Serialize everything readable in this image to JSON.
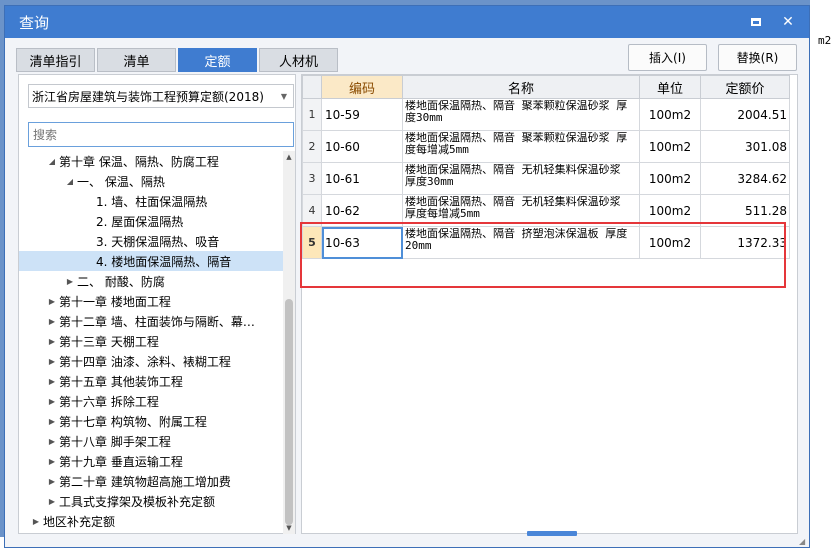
{
  "window": {
    "title": "查询"
  },
  "background": {
    "unit_text": "m2"
  },
  "tabs": [
    {
      "label": "清单指引"
    },
    {
      "label": "清单"
    },
    {
      "label": "定额"
    },
    {
      "label": "人材机"
    }
  ],
  "active_tab": "定额",
  "buttons": {
    "insert": "插入(I)",
    "replace": "替换(R)"
  },
  "quota_select": {
    "value": "浙江省房屋建筑与装饰工程预算定额(2018)"
  },
  "search": {
    "placeholder": "搜索"
  },
  "tree": [
    {
      "label": "第十章 保温、隔热、防腐工程",
      "level": 1,
      "expanded": true
    },
    {
      "label": "一、 保温、隔热",
      "level": 2,
      "expanded": true
    },
    {
      "label": "1.  墙、柱面保温隔热",
      "level": 3
    },
    {
      "label": "2.  屋面保温隔热",
      "level": 3
    },
    {
      "label": "3.  天棚保温隔热、吸音",
      "level": 3
    },
    {
      "label": "4.  楼地面保温隔热、隔音",
      "level": 3,
      "selected": true
    },
    {
      "label": "二、 耐酸、防腐",
      "level": 2,
      "expanded": false
    },
    {
      "label": "第十一章 楼地面工程",
      "level": 1,
      "expanded": false
    },
    {
      "label": "第十二章 墙、柱面装饰与隔断、幕…",
      "level": 1,
      "expanded": false
    },
    {
      "label": "第十三章 天棚工程",
      "level": 1,
      "expanded": false
    },
    {
      "label": "第十四章 油漆、涂料、裱糊工程",
      "level": 1,
      "expanded": false
    },
    {
      "label": "第十五章 其他装饰工程",
      "level": 1,
      "expanded": false
    },
    {
      "label": "第十六章 拆除工程",
      "level": 1,
      "expanded": false
    },
    {
      "label": "第十七章 构筑物、附属工程",
      "level": 1,
      "expanded": false
    },
    {
      "label": "第十八章 脚手架工程",
      "level": 1,
      "expanded": false
    },
    {
      "label": "第十九章 垂直运输工程",
      "level": 1,
      "expanded": false
    },
    {
      "label": "第二十章 建筑物超高施工增加费",
      "level": 1,
      "expanded": false
    },
    {
      "label": "工具式支撑架及模板补充定额",
      "level": 1,
      "expanded": false
    },
    {
      "label": "地区补充定额",
      "level": 0,
      "expanded": false
    }
  ],
  "table": {
    "headers": {
      "code": "编码",
      "name": "名称",
      "unit": "单位",
      "price": "定额价"
    },
    "rows": [
      {
        "no": "1",
        "code": "10-59",
        "name": "楼地面保温隔热、隔音 聚苯颗粒保温砂浆 厚度30mm",
        "unit": "100m2",
        "price": "2004.51"
      },
      {
        "no": "2",
        "code": "10-60",
        "name": "楼地面保温隔热、隔音 聚苯颗粒保温砂浆 厚度每增减5mm",
        "unit": "100m2",
        "price": "301.08"
      },
      {
        "no": "3",
        "code": "10-61",
        "name": "楼地面保温隔热、隔音 无机轻集料保温砂浆 厚度30mm",
        "unit": "100m2",
        "price": "3284.62"
      },
      {
        "no": "4",
        "code": "10-62",
        "name": "楼地面保温隔热、隔音 无机轻集料保温砂浆 厚度每增减5mm",
        "unit": "100m2",
        "price": "511.28"
      },
      {
        "no": "5",
        "code": "10-63",
        "name": "楼地面保温隔热、隔音 挤塑泡沫保温板 厚度20mm",
        "unit": "100m2",
        "price": "1372.33"
      }
    ]
  },
  "colors": {
    "accent": "#3f7cd0",
    "highlight_box": "#e5363a",
    "selected_row": "#cde2f7"
  }
}
